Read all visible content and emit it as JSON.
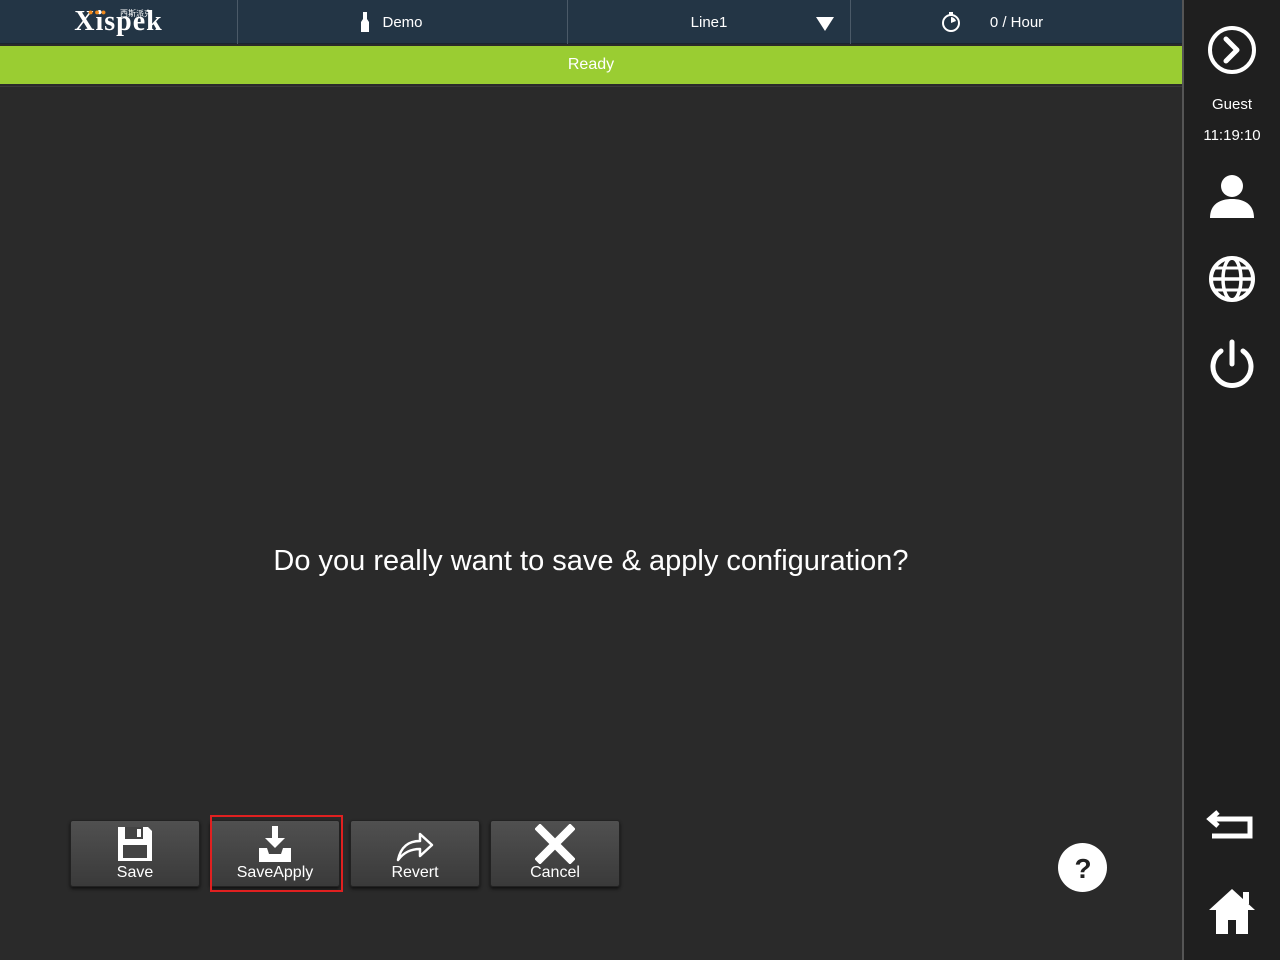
{
  "header": {
    "logo_text": "Xispek",
    "logo_sub": "西斯派克",
    "product": "Demo",
    "line": "Line1",
    "rate": "0 / Hour"
  },
  "status": {
    "text": "Ready"
  },
  "dialog": {
    "message": "Do you really want to save & apply configuration?"
  },
  "actions": {
    "save_label": "Save",
    "saveapply_label": "SaveApply",
    "revert_label": "Revert",
    "cancel_label": "Cancel"
  },
  "sidebar": {
    "user": "Guest",
    "time": "11:19:10"
  },
  "colors": {
    "header_bg": "#233545",
    "status_bg": "#9acd32",
    "highlight": "#e02020",
    "logo_accent": "#f28a1b"
  }
}
